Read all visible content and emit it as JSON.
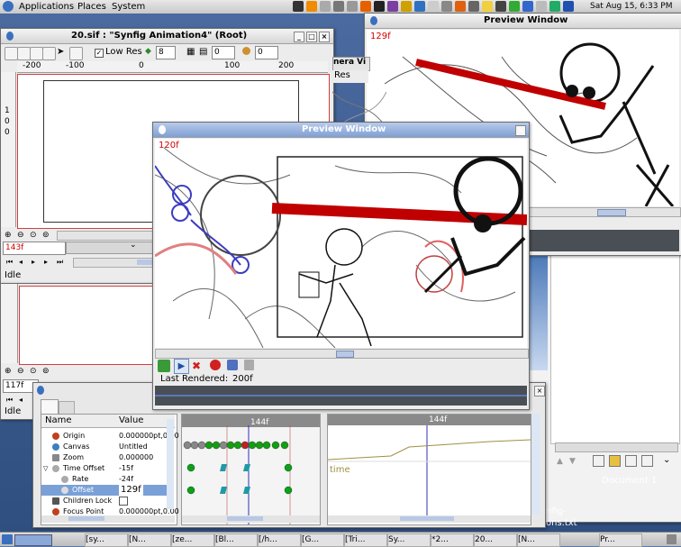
{
  "top_panel": {
    "applications": "Applications",
    "places": "Places",
    "system": "System",
    "clock": "Sat Aug 15, 6:33 PM"
  },
  "canvas_window": {
    "title": "20.sif : \"Synfig Animation4\" (Root)",
    "low_res_label": "Low Res",
    "low_res_value": "8",
    "field_a": "0",
    "field_b": "0",
    "ruler_ticks": [
      "-200",
      "-100",
      "0",
      "100",
      "200"
    ],
    "vertical_ruler": [
      "1",
      "0",
      "0"
    ],
    "time_field": "143f",
    "status": "Idle"
  },
  "second_canvas": {
    "time_field": "117f",
    "status": "Idle"
  },
  "partial_window": {
    "title_fragment": "nera Vi",
    "low_res_fragment": "Res"
  },
  "preview_back": {
    "title": "Preview Window",
    "frame": "129f"
  },
  "preview_front": {
    "title": "Preview Window",
    "frame": "120f",
    "last_rendered_label": "Last Rendered:",
    "last_rendered_value": "200f"
  },
  "params_panel": {
    "col_name": "Name",
    "col_value": "Value",
    "rows": [
      {
        "name": "Origin",
        "value": "0.000000pt,0.00"
      },
      {
        "name": "Canvas",
        "value": "Untitled"
      },
      {
        "name": "Zoom",
        "value": "0.000000"
      },
      {
        "name": "Time Offset",
        "value": "-15f"
      },
      {
        "name": "Rate",
        "value": "-24f"
      },
      {
        "name": "Offset",
        "value": "129f"
      },
      {
        "name": "Children Lock",
        "value": ""
      },
      {
        "name": "Focus Point",
        "value": "0.000000pt,0.00"
      }
    ],
    "timetrack_marker": "144f",
    "graph_marker": "144f",
    "graph_label": "time"
  },
  "right_panel": {
    "document_label": "Document 1"
  },
  "desktop": {
    "file_label_1": "nfig-",
    "file_label_2": "ons.txt"
  },
  "taskbar": {
    "items": [
      "[sy...",
      "[N...",
      "[ze...",
      "[Bl...",
      "[/h...",
      "[G...",
      "[Tri...",
      "Sy...",
      "*2...",
      "20...",
      "[N...",
      "Pr..."
    ]
  },
  "colors": {
    "accent_red": "#d40000",
    "sketch_red": "#c00000",
    "keyframe_green": "#10a010",
    "waypoint_teal": "#1e9aa6"
  }
}
